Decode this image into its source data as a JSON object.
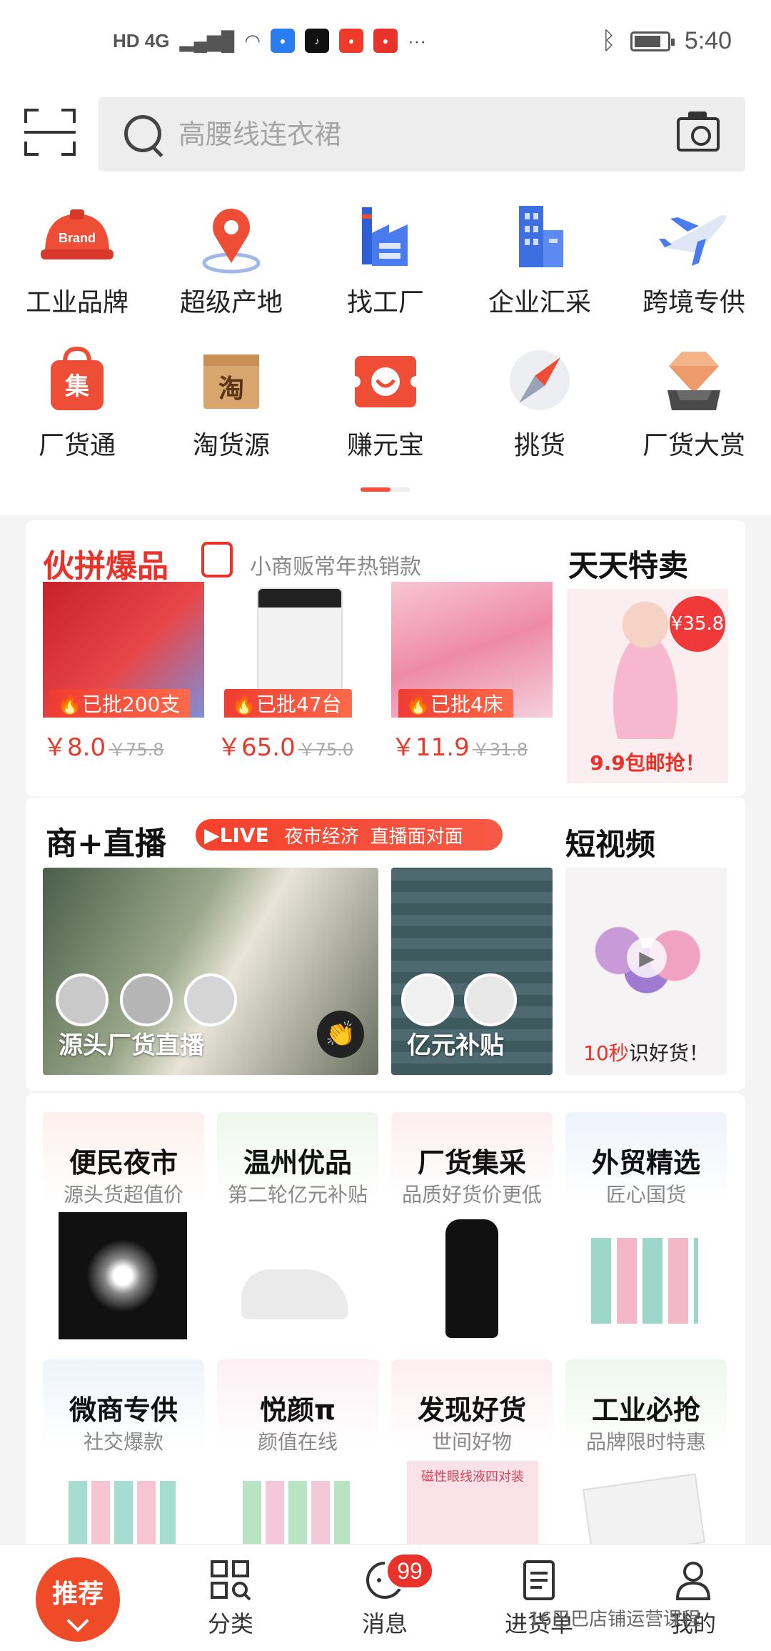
{
  "status_bar": {
    "network": "HD 4G",
    "time": "5:40"
  },
  "search": {
    "placeholder": "高腰线连衣裙"
  },
  "categories": [
    {
      "label": "工业品牌",
      "icon": "brand-helmet-icon",
      "icon_text": "Brand"
    },
    {
      "label": "超级产地",
      "icon": "location-pin-icon"
    },
    {
      "label": "找工厂",
      "icon": "factory-icon"
    },
    {
      "label": "企业汇采",
      "icon": "building-icon"
    },
    {
      "label": "跨境专供",
      "icon": "airplane-icon"
    },
    {
      "label": "厂货通",
      "icon": "shopping-bag-icon",
      "icon_text": "集"
    },
    {
      "label": "淘货源",
      "icon": "box-icon",
      "icon_text": "淘"
    },
    {
      "label": "赚元宝",
      "icon": "coupon-icon"
    },
    {
      "label": "挑货",
      "icon": "compass-icon"
    },
    {
      "label": "厂货大赏",
      "icon": "diamond-icon"
    }
  ],
  "group_buy": {
    "title": "伙拼爆品",
    "subtitle": "小商贩常年热销款",
    "products": [
      {
        "tag": "已批200支",
        "price": "￥8.0",
        "old_price": "￥75.8"
      },
      {
        "tag": "已批47台",
        "price": "￥65.0",
        "old_price": "￥75.0"
      },
      {
        "tag": "已批4床",
        "price": "￥11.9",
        "old_price": "￥31.8"
      }
    ]
  },
  "daily_sale": {
    "title": "天天特卖",
    "price_badge": "¥35.8",
    "promo": "9.9包邮抢！"
  },
  "live": {
    "title": "商+直播",
    "badge_live": "▶LIVE",
    "badge_text1": "夜市经济",
    "badge_text2": "直播面对面",
    "tile1_label": "源头厂货直播",
    "tile2_label": "亿元补贴"
  },
  "short_video": {
    "title": "短视频",
    "caption_highlight": "10秒",
    "caption_rest": "识好货！"
  },
  "channels": [
    {
      "title": "便民夜市",
      "subtitle": "源头货超值价"
    },
    {
      "title": "温州优品",
      "subtitle": "第二轮亿元补贴"
    },
    {
      "title": "厂货集采",
      "subtitle": "品质好货价更低"
    },
    {
      "title": "外贸精选",
      "subtitle": "匠心国货"
    },
    {
      "title": "微商专供",
      "subtitle": "社交爆款"
    },
    {
      "title": "悦颜π",
      "subtitle": "颜值在线"
    },
    {
      "title": "发现好货",
      "subtitle": "世间好物"
    },
    {
      "title": "工业必抢",
      "subtitle": "品牌限时特惠"
    }
  ],
  "channel_extra_text": "磁性眼线液四对装",
  "bottom_nav": {
    "recommend": "推荐",
    "category": "分类",
    "messages": "消息",
    "messages_badge": "99",
    "cart": "进货单",
    "mine": "我的"
  },
  "watermark": "16巴巴店铺运营课程",
  "colors": {
    "accent": "#f0503c",
    "price_red": "#e83a2a",
    "title_red": "#e8322a"
  }
}
